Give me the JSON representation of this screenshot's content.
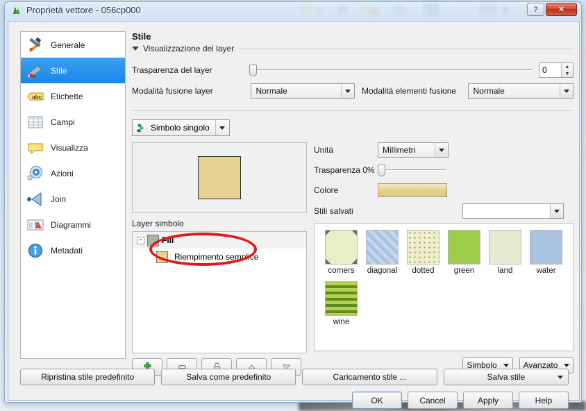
{
  "window": {
    "title": "Proprietà vettore - 056cp000",
    "icon": "qgis-layer-icon",
    "help_button": "?",
    "close_button": "✕"
  },
  "sidebar": {
    "items": [
      {
        "label": "Generale",
        "icon": "tools-icon",
        "selected": false
      },
      {
        "label": "Stile",
        "icon": "paintbrush-icon",
        "selected": true
      },
      {
        "label": "Etichette",
        "icon": "abc-label-icon",
        "selected": false
      },
      {
        "label": "Campi",
        "icon": "table-icon",
        "selected": false
      },
      {
        "label": "Visualizza",
        "icon": "speech-bubble-icon",
        "selected": false
      },
      {
        "label": "Azioni",
        "icon": "action-play-icon",
        "selected": false
      },
      {
        "label": "Join",
        "icon": "join-arrow-icon",
        "selected": false
      },
      {
        "label": "Diagrammi",
        "icon": "diagram-icon",
        "selected": false
      },
      {
        "label": "Metadati",
        "icon": "info-icon",
        "selected": false
      }
    ]
  },
  "pane": {
    "title": "Stile",
    "layer_rendering": {
      "group_label": "Visualizzazione del layer",
      "transparency_label": "Trasparenza del layer",
      "transparency_value": "0",
      "layer_blend_label": "Modalità fusione layer",
      "layer_blend_value": "Normale",
      "feature_blend_label": "Modalità elementi fusione",
      "feature_blend_value": "Normale"
    },
    "renderer": {
      "label": "Simbolo singolo",
      "icon": "single-symbol-icon"
    },
    "preview": {
      "symbol_fill_color": "#e6d391",
      "symbol_border_color": "#2b2b2b"
    },
    "symbol_layers": {
      "label": "Layer simbolo",
      "nodes": [
        {
          "label": "Fill",
          "swatch": "#a9b5a3",
          "bold": true,
          "expander": "−",
          "level": 0
        },
        {
          "label": "Riempimento semplice",
          "swatch": "#e6d391",
          "bold": false,
          "level": 1
        }
      ],
      "buttons": [
        {
          "name": "add-symbol-layer-button",
          "icon": "plus-icon"
        },
        {
          "name": "remove-symbol-layer-button",
          "icon": "minus-icon"
        },
        {
          "name": "lock-symbol-layer-button",
          "icon": "lock-icon"
        },
        {
          "name": "move-up-button",
          "icon": "arrow-up-icon"
        },
        {
          "name": "move-down-button",
          "icon": "arrow-down-icon"
        }
      ]
    },
    "symbol_settings": {
      "unit_label": "Unità",
      "unit_value": "Millimetri",
      "transparency_label": "Trasparenza 0%",
      "color_label": "Colore",
      "color_value": "#e6d391",
      "saved_styles_label": "Stili salvati",
      "saved_styles_value": ""
    },
    "style_swatches": [
      {
        "name": "corners",
        "color": "#eaeec6",
        "pattern": "corners"
      },
      {
        "name": "diagonal",
        "color": "#a9c3e0",
        "pattern": "diagonal"
      },
      {
        "name": "dotted",
        "color": "#f0efcd",
        "pattern": "dotted"
      },
      {
        "name": "green",
        "color": "#9ccc4a",
        "pattern": "solid"
      },
      {
        "name": "land",
        "color": "#e5ead0",
        "pattern": "solid"
      },
      {
        "name": "water",
        "color": "#a9c3e0",
        "pattern": "solid"
      },
      {
        "name": "wine",
        "color": "#b4d255",
        "pattern": "dashes"
      }
    ],
    "symbol_buttons": {
      "symbol_label": "Simbolo",
      "advanced_label": "Avanzato"
    }
  },
  "bottom": {
    "restore_default_style": "Ripristina stile predefinito",
    "save_as_default": "Salva come predefinito",
    "load_style": "Caricamento stile ...",
    "save_style": "Salva stile",
    "ok": "OK",
    "cancel": "Cancel",
    "apply": "Apply",
    "help": "Help"
  },
  "annotation": {
    "shape": "red-ellipse-highlight",
    "color": "#e01b1b"
  }
}
